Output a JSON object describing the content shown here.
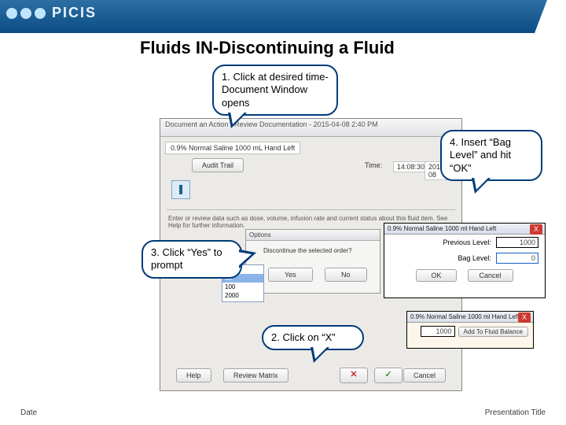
{
  "header": {
    "brand": "PICIS"
  },
  "title": "Fluids IN-Discontinuing a Fluid",
  "callouts": {
    "step1": "1. Click at desired time-Document Window opens",
    "step2": "2. Click on “X”",
    "step3": "3. Click “Yes” to prompt",
    "step4": "4. Insert “Bag Level” and hit “OK”"
  },
  "main_dialog": {
    "window_title": "Document an Action / Review Documentation - 2015-04-08 2:40 PM",
    "fluid_name": "0.9% Normal Saline 1000 mL Hand Left",
    "audit_trail_btn": "Audit Trail",
    "time_label": "Time:",
    "time_value": "14:08:30",
    "date_value": "2015-04-08",
    "instruction": "Enter or review data such as dose, volume, infusion rate and current status about this fluid item. See Help for further information.",
    "help_btn": "Help",
    "review_btn": "Review Matrix",
    "cancel_btn": "Cancel"
  },
  "prompt": {
    "title": "Options",
    "text": "Discontinue the selected order?",
    "yes": "Yes",
    "no": "No"
  },
  "listbox": [
    "25",
    "50",
    "100",
    "2000"
  ],
  "inset": {
    "title": "0.9% Normal Saline 1000 ml  Hand Left",
    "close": "X",
    "value": "1000",
    "addbtn": "Add To Fluid Balance"
  },
  "bag": {
    "title": "0.9% Normal Saline 1000 ml  Hand Left",
    "close": "X",
    "prev_label": "Previous Level:",
    "prev_value": "1000",
    "bag_label": "Bag Level:",
    "bag_value": "0",
    "ok": "OK",
    "cancel": "Cancel"
  },
  "footer": {
    "left": "Date",
    "right": "Presentation Title"
  }
}
